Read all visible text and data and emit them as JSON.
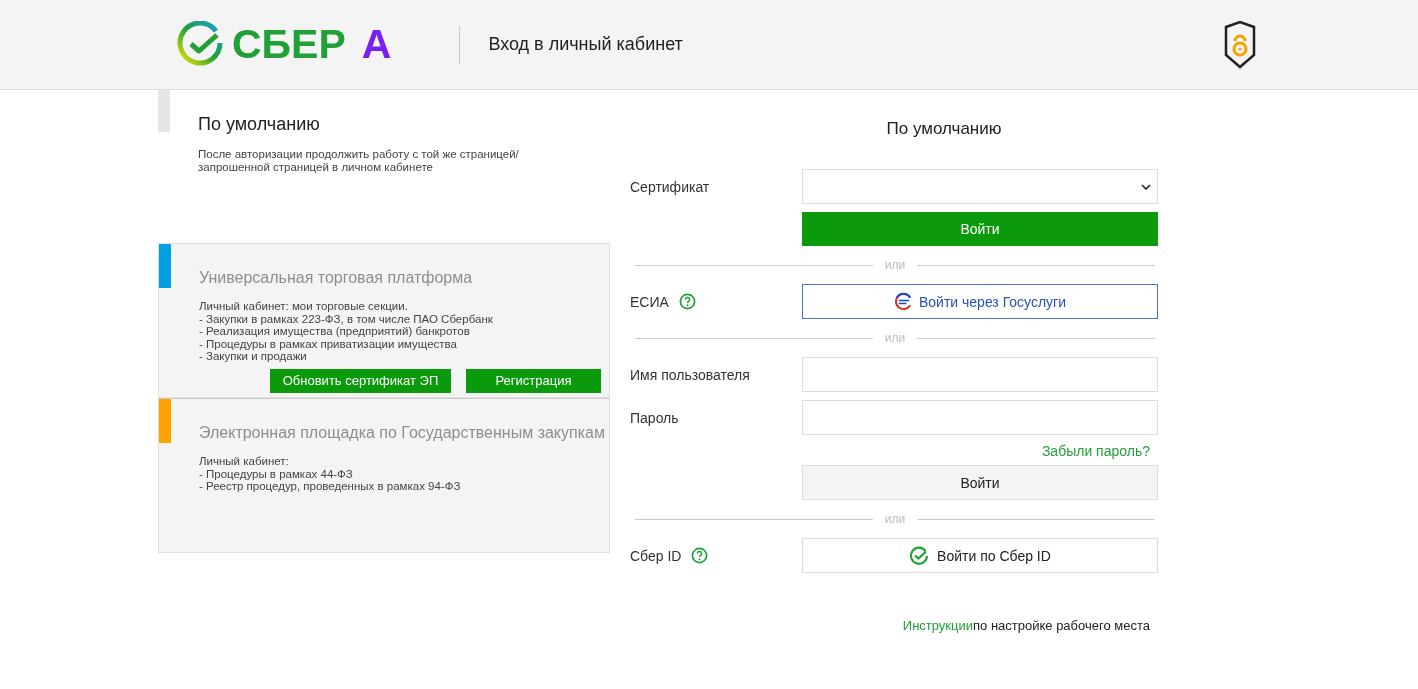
{
  "header": {
    "logo": {
      "word": "СБЕР",
      "letter": "А"
    },
    "title": "Вход в личный кабинет"
  },
  "sections": [
    {
      "kind": "default",
      "color": "#e6e6e6",
      "title": "По умолчанию",
      "lines": [
        "После авторизации продолжить работу с той же страницей/ запрошенной страницей в личном кабинете"
      ]
    },
    {
      "kind": "platform",
      "color": "#00a0e3",
      "title": "Универсальная торговая платформа",
      "lines": [
        "Личный кабинет: мои торговые секции.",
        "- Закупки в рамках 223-ФЗ, в том числе ПАО Сбербанк",
        "- Реализация имущества (предприятий) банкротов",
        "- Процедуры в рамках приватизации имущества",
        "- Закупки и продажи"
      ],
      "buttons": [
        "Обновить сертификат ЭП",
        "Регистрация"
      ]
    },
    {
      "kind": "platform",
      "color": "#ffa200",
      "title": "Электронная площадка по Государственным закупкам",
      "lines": [
        "Личный кабинет:",
        "- Процедуры в рамках 44-ФЗ",
        "- Реестр процедур, проведенных в рамках 94-ФЗ"
      ]
    }
  ],
  "login": {
    "title": "По умолчанию",
    "rows": [
      {
        "kind": "select",
        "label": "Сертификат"
      },
      {
        "kind": "primary",
        "text": "Войти"
      },
      {
        "kind": "separator",
        "text": "или"
      },
      {
        "kind": "gosuslugi",
        "label": "ЕСИА",
        "text": "Войти через Госуслуги"
      },
      {
        "kind": "separator",
        "text": "или"
      },
      {
        "kind": "input",
        "label": "Имя пользователя"
      },
      {
        "kind": "input",
        "label": "Пароль"
      },
      {
        "kind": "link",
        "text": "Забыли пароль?"
      },
      {
        "kind": "secondary",
        "text": "Войти"
      },
      {
        "kind": "separator",
        "text": "или"
      },
      {
        "kind": "sberid",
        "label": "Сбер ID",
        "text": "Войти по Сбер ID"
      }
    ],
    "footer": {
      "link": "Инструкции",
      "text": "по настройке рабочего места"
    }
  }
}
